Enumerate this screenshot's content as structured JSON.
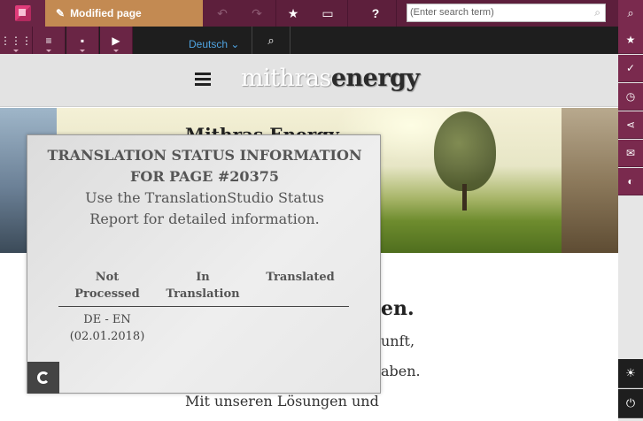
{
  "toolbar": {
    "modified_label": "Modified page",
    "help_label": "?",
    "search_placeholder": "(Enter search term)"
  },
  "bar2": {
    "language": "Deutsch"
  },
  "site": {
    "logo_part1": "mithras",
    "logo_part2": "energy",
    "hero_title": "Mithras Energy",
    "text_heading": "en.",
    "text_line1": "unft,",
    "text_line2": "aben.",
    "text_line3": "Mit unseren Lösungen und"
  },
  "popup": {
    "title_line1": "TRANSLATION STATUS INFORMATION",
    "title_line2": "FOR PAGE #20375",
    "subtitle_line1": "Use the TranslationStudio Status",
    "subtitle_line2": "Report for detailed information.",
    "columns": [
      {
        "line1": "Not",
        "line2": "Processed"
      },
      {
        "line1": "In",
        "line2": "Translation"
      },
      {
        "line1": "Translated",
        "line2": ""
      }
    ],
    "row": {
      "line1": "DE - EN",
      "line2": "(02.01.2018)"
    }
  },
  "colors": {
    "toolbar": "#5d1f3c",
    "modified_badge": "#c38a52",
    "accent": "#7a2a4e",
    "link": "#4fa3e0"
  }
}
